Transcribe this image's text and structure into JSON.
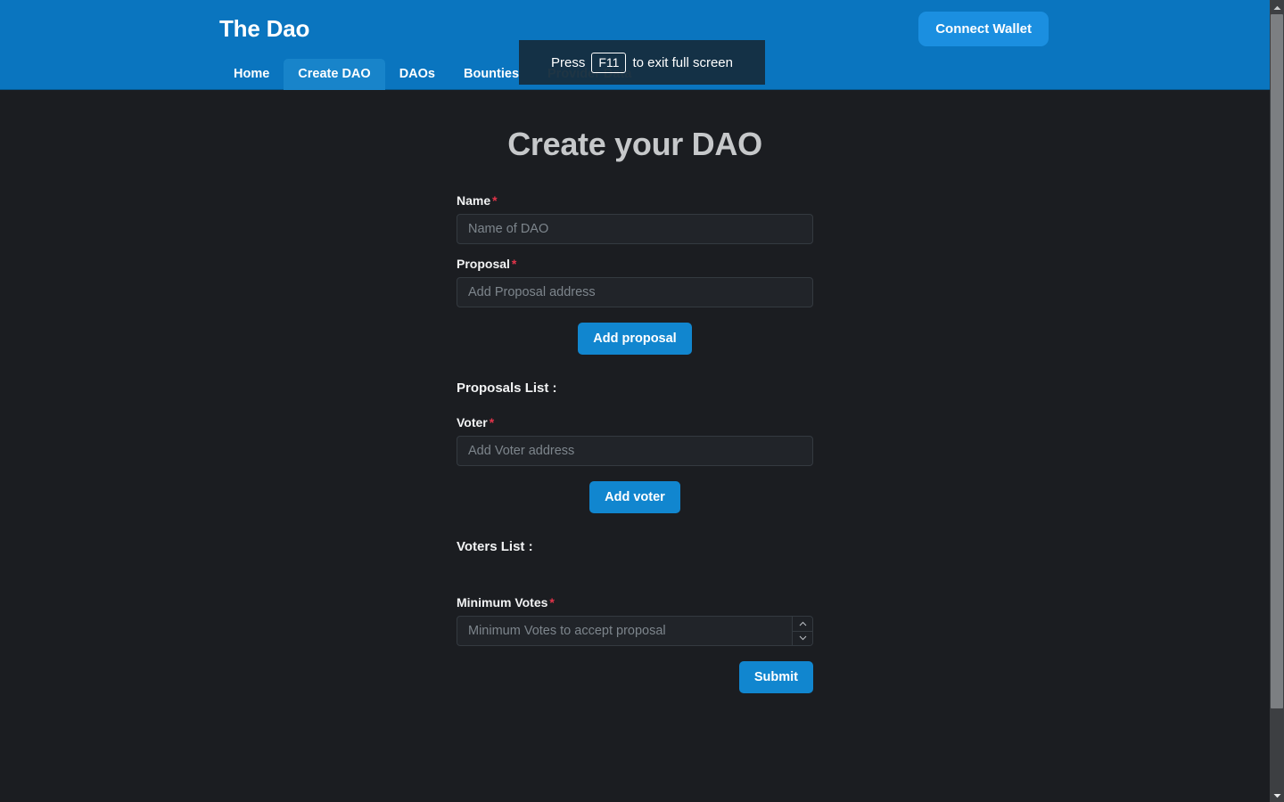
{
  "header": {
    "brand": "The Dao",
    "connect_wallet_label": "Connect Wallet",
    "nav": [
      {
        "label": "Home",
        "active": false
      },
      {
        "label": "Create DAO",
        "active": true
      },
      {
        "label": "DAOs",
        "active": false
      },
      {
        "label": "Bounties",
        "active": false
      },
      {
        "label": "Provider Data",
        "active": false
      }
    ],
    "colors": {
      "header_bg": "#0a75bf",
      "active_tab_bg": "#1884ca",
      "connect_wallet_bg": "#1b8fe0"
    }
  },
  "fullscreen_toast": {
    "prefix": "Press",
    "key": "F11",
    "suffix": "to exit full screen"
  },
  "main": {
    "title": "Create your DAO",
    "required_marker": "*",
    "fields": {
      "name": {
        "label": "Name",
        "placeholder": "Name of DAO",
        "value": ""
      },
      "proposal": {
        "label": "Proposal",
        "placeholder": "Add Proposal address",
        "value": ""
      },
      "voter": {
        "label": "Voter",
        "placeholder": "Add Voter address",
        "value": ""
      },
      "minimum_votes": {
        "label": "Minimum Votes",
        "placeholder": "Minimum Votes to accept proposal",
        "value": ""
      }
    },
    "buttons": {
      "add_proposal": "Add proposal",
      "add_voter": "Add voter",
      "submit": "Submit"
    },
    "lists": {
      "proposals_heading": "Proposals List :",
      "voters_heading": "Voters List :",
      "proposals_items": [],
      "voters_items": []
    },
    "colors": {
      "page_bg": "#1b1d21",
      "title": "#c6c8ca",
      "button_bg": "#1186cf",
      "required_asterisk": "#e3344a",
      "input_bg": "#212429",
      "input_border": "#343a40"
    }
  },
  "scrollbar": {
    "up_arrow_icon": "caret-up-icon",
    "down_arrow_icon": "caret-down-icon",
    "thumb": "scrollbar-thumb"
  }
}
